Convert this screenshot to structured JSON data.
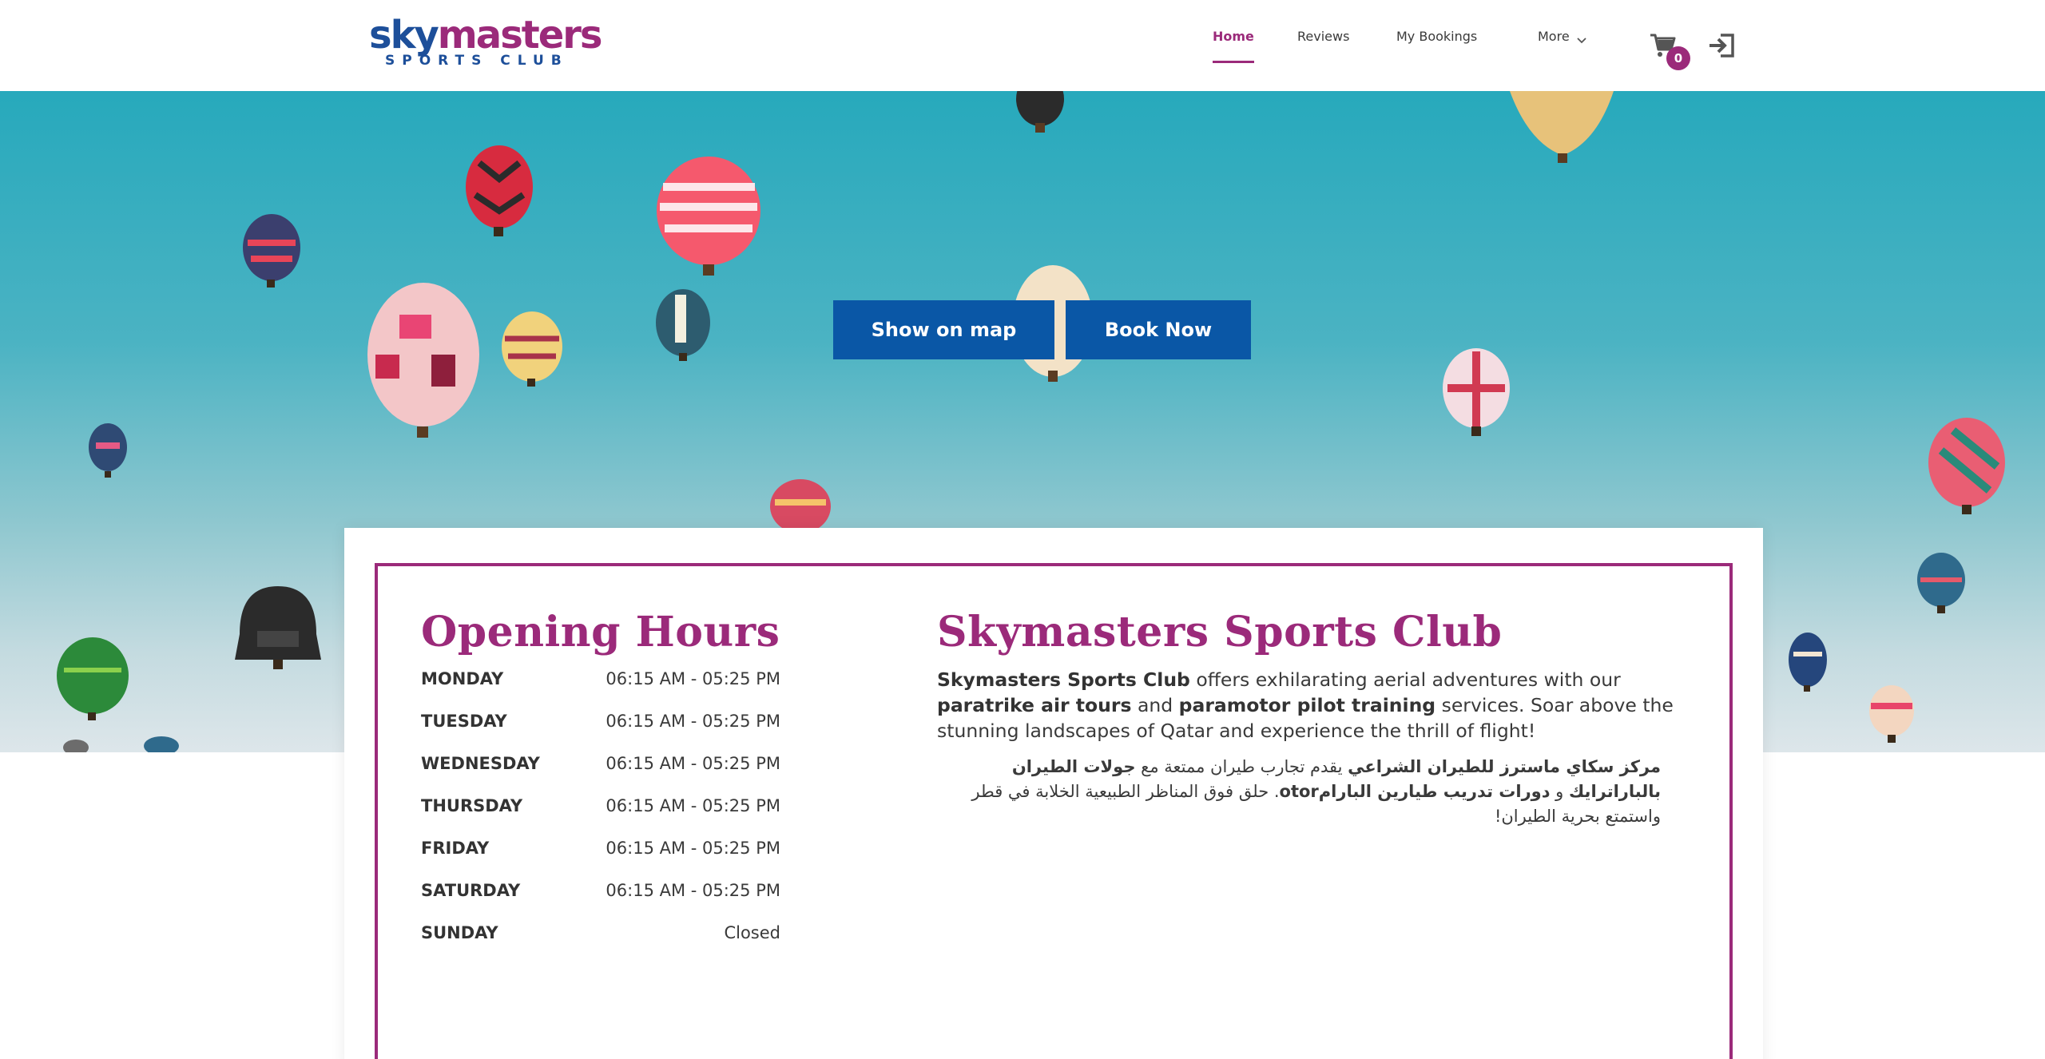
{
  "brand": {
    "logo_top_a": "sky",
    "logo_top_b": "masters",
    "logo_bottom": "SPORTS CLUB",
    "primary_color": "#9b2a7a",
    "secondary_color": "#1d4f9a"
  },
  "nav": {
    "items": [
      {
        "label": "Home",
        "active": true
      },
      {
        "label": "Reviews",
        "active": false
      },
      {
        "label": "My Bookings",
        "active": false
      },
      {
        "label": "More",
        "active": false
      }
    ],
    "cart_icon": "cart-icon",
    "cart_count": "0",
    "login_icon": "login-icon"
  },
  "hero": {
    "show_on_map_label": "Show on map",
    "book_now_label": "Book Now",
    "button_color": "#0a57a6"
  },
  "opening_hours": {
    "title": "Opening Hours",
    "days": [
      {
        "day": "MONDAY",
        "time": "06:15 AM - 05:25 PM"
      },
      {
        "day": "TUESDAY",
        "time": "06:15 AM - 05:25 PM"
      },
      {
        "day": "WEDNESDAY",
        "time": "06:15 AM - 05:25 PM"
      },
      {
        "day": "THURSDAY",
        "time": "06:15 AM - 05:25 PM"
      },
      {
        "day": "FRIDAY",
        "time": "06:15 AM - 05:25 PM"
      },
      {
        "day": "SATURDAY",
        "time": "06:15 AM - 05:25 PM"
      },
      {
        "day": "SUNDAY",
        "time": "Closed"
      }
    ]
  },
  "about": {
    "title": "Skymasters Sports Club",
    "en": {
      "p1_bold": "Skymasters Sports Club",
      "p2": " offers exhilarating aerial adventures with our ",
      "p3_bold": "paratrike air tours",
      "p4": " and ",
      "p5_bold": "paramotor pilot training",
      "p6": " services. Soar above the stunning landscapes of Qatar and experience the thrill of flight!"
    },
    "ar": {
      "a1_bold": "مركز سكاي ماسترز للطيران الشراعي",
      "a2": " يقدم تجارب طيران ممتعة مع ",
      "a3_bold": "جولات الطيران بالباراترايك",
      "a4": " و ",
      "a5_bold": "دورات تدريب طيارين البارامotor",
      "a6": ". حلق فوق المناظر الطبيعية الخلابة في قطر واستمتع بحرية الطيران!"
    }
  }
}
